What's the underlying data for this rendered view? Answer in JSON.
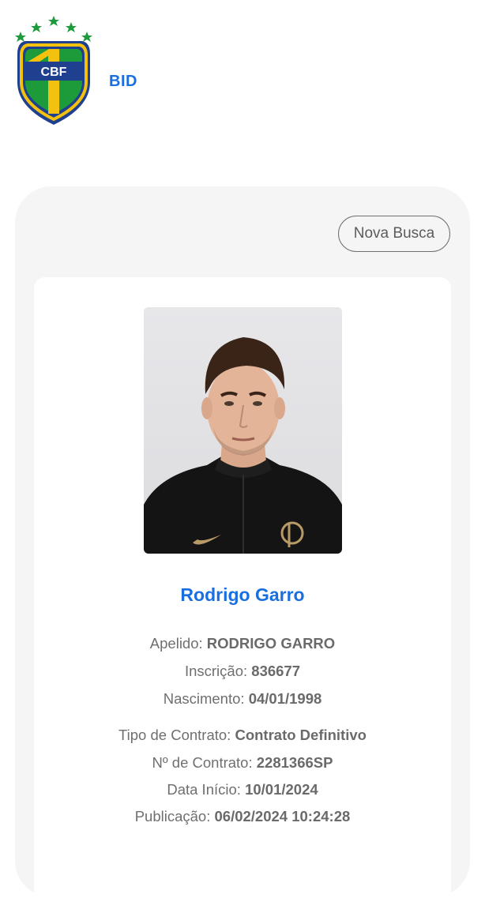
{
  "header": {
    "crest_text": "CBF",
    "section_label": "BID"
  },
  "actions": {
    "new_search_label": "Nova Busca"
  },
  "player": {
    "name": "Rodrigo Garro",
    "fields": {
      "apelido_label": "Apelido:",
      "apelido_value": "RODRIGO GARRO",
      "inscricao_label": "Inscrição:",
      "inscricao_value": "836677",
      "nascimento_label": "Nascimento:",
      "nascimento_value": "04/01/1998"
    },
    "contract": {
      "tipo_label": "Tipo de Contrato:",
      "tipo_value": "Contrato Definitivo",
      "numero_label": "Nº de Contrato:",
      "numero_value": "2281366SP",
      "inicio_label": "Data Início:",
      "inicio_value": "10/01/2024",
      "publicacao_label": "Publicação:",
      "publicacao_value": "06/02/2024 10:24:28"
    }
  },
  "colors": {
    "accent_blue": "#1a6fe0",
    "crest_yellow": "#f4c10f",
    "crest_green": "#1d9a3a",
    "crest_blue": "#1f3f8f",
    "panel_bg": "#f5f5f5"
  }
}
